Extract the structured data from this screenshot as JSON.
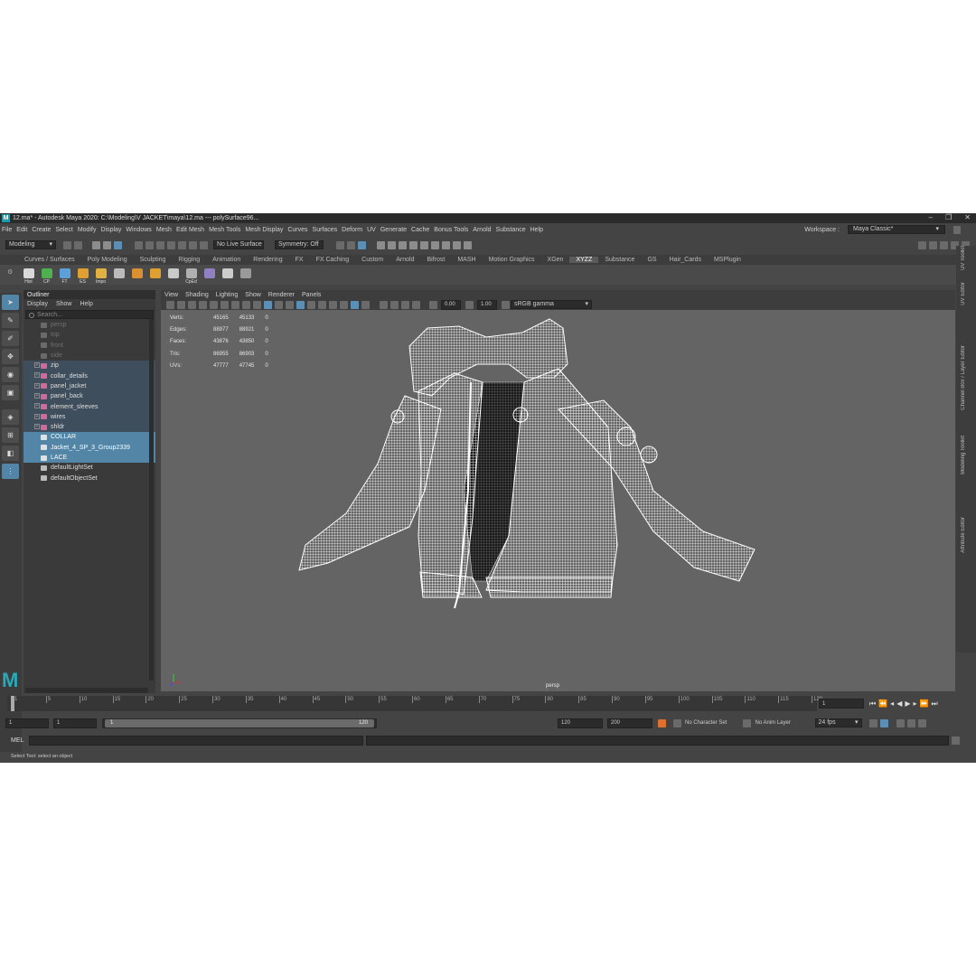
{
  "window": {
    "title": "12.ma* - Autodesk Maya 2020: C:\\Modeling\\V JACKET\\maya\\12.ma  ---  polySurface96..."
  },
  "menubar": {
    "items": [
      "File",
      "Edit",
      "Create",
      "Select",
      "Modify",
      "Display",
      "Windows",
      "Mesh",
      "Edit Mesh",
      "Mesh Tools",
      "Mesh Display",
      "Curves",
      "Surfaces",
      "Deform",
      "UV",
      "Generate",
      "Cache",
      "Bonus Tools",
      "Arnold",
      "Substance",
      "Help"
    ],
    "workspace_label": "Workspace :",
    "workspace_value": "Maya Classic*"
  },
  "statusline": {
    "menu_set": "Modeling",
    "live_surface": "No Live Surface",
    "symmetry": "Symmetry: Off"
  },
  "shelf": {
    "tabs": [
      "Curves / Surfaces",
      "Poly Modeling",
      "Sculpting",
      "Rigging",
      "Animation",
      "Rendering",
      "FX",
      "FX Caching",
      "Custom",
      "Arnold",
      "Bifrost",
      "MASH",
      "Motion Graphics",
      "XGen",
      "XYZZ",
      "Substance",
      "GS",
      "Hair_Cards",
      "MSPlugin"
    ],
    "active_tab": "XYZZ",
    "buttons": [
      {
        "label": "Hist",
        "color": "#d8d8d8"
      },
      {
        "label": "CP",
        "color": "#4fb04f"
      },
      {
        "label": "FT",
        "color": "#5ba0d8"
      },
      {
        "label": "ES",
        "color": "#e0a030"
      },
      {
        "label": "Impo",
        "color": "#e0b040"
      },
      {
        "label": "",
        "color": "#bbbbbb"
      },
      {
        "label": "",
        "color": "#d89030"
      },
      {
        "label": "",
        "color": "#e0a030"
      },
      {
        "label": "",
        "color": "#c9c9c9"
      },
      {
        "label": "CpEd",
        "color": "#b0b0b0"
      },
      {
        "label": "",
        "color": "#9080c0"
      },
      {
        "label": "",
        "color": "#cccccc"
      },
      {
        "label": "",
        "color": "#9a9a9a"
      }
    ]
  },
  "outliner": {
    "title": "Outliner",
    "menu": [
      "Display",
      "Show",
      "Help"
    ],
    "search_placeholder": "Search...",
    "items": [
      {
        "label": "persp",
        "kind": "camera"
      },
      {
        "label": "top",
        "kind": "camera"
      },
      {
        "label": "front",
        "kind": "camera"
      },
      {
        "label": "side",
        "kind": "camera"
      },
      {
        "label": "zip",
        "kind": "group"
      },
      {
        "label": "collar_details",
        "kind": "group"
      },
      {
        "label": "panel_jacket",
        "kind": "group"
      },
      {
        "label": "panel_back",
        "kind": "group"
      },
      {
        "label": "element_sleeves",
        "kind": "group"
      },
      {
        "label": "wires",
        "kind": "group"
      },
      {
        "label": "shldr",
        "kind": "group"
      },
      {
        "label": "COLLAR",
        "kind": "selected"
      },
      {
        "label": "Jacket_4_SP_3_Group2339",
        "kind": "selected"
      },
      {
        "label": "LACE",
        "kind": "selected"
      },
      {
        "label": "defaultLightSet",
        "kind": "set"
      },
      {
        "label": "defaultObjectSet",
        "kind": "set"
      }
    ]
  },
  "viewport": {
    "menu": [
      "View",
      "Shading",
      "Lighting",
      "Show",
      "Renderer",
      "Panels"
    ],
    "exposure": "0.00",
    "gamma": "1.00",
    "color_space": "sRGB gamma",
    "camera_label": "persp",
    "hud": [
      {
        "label": "Verts:",
        "a": "45165",
        "b": "45133",
        "c": "0"
      },
      {
        "label": "Edges:",
        "a": "88977",
        "b": "88921",
        "c": "0"
      },
      {
        "label": "Faces:",
        "a": "43876",
        "b": "43850",
        "c": "0"
      },
      {
        "label": "Tris:",
        "a": "86955",
        "b": "86903",
        "c": "0"
      },
      {
        "label": "UVs:",
        "a": "47777",
        "b": "47745",
        "c": "0"
      }
    ]
  },
  "side_tabs": [
    "UV Toolkit",
    "UV Editor",
    "Channel Box / Layer Editor",
    "Modeling Toolkit",
    "Attribute Editor"
  ],
  "timeline": {
    "ticks": [
      "1",
      "5",
      "10",
      "15",
      "20",
      "25",
      "30",
      "35",
      "40",
      "45",
      "50",
      "55",
      "60",
      "65",
      "70",
      "75",
      "80",
      "85",
      "90",
      "95",
      "100",
      "105",
      "110",
      "115",
      "120"
    ],
    "current_frame": "1"
  },
  "range": {
    "start": "1",
    "playback_start": "1",
    "slider_start": "1",
    "slider_end": "120",
    "playback_end": "120",
    "end": "200",
    "character_set": "No Character Set",
    "anim_layer": "No Anim Layer",
    "fps": "24 fps"
  },
  "command": {
    "mel_label": "MEL"
  },
  "helpline": {
    "text": "Select Tool: select an object"
  }
}
